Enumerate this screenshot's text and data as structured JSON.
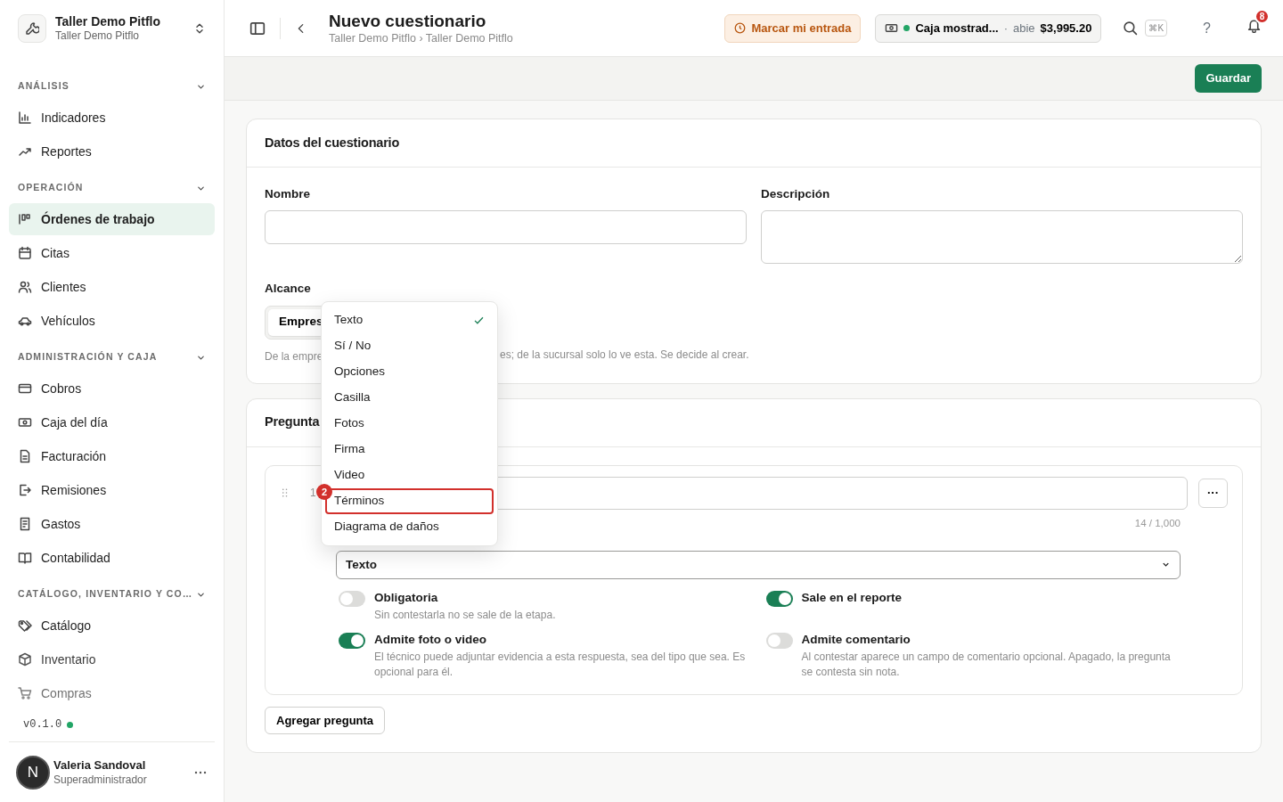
{
  "sidebar": {
    "workspace": {
      "name": "Taller Demo Pitflo",
      "subtitle": "Taller Demo Pitflo"
    },
    "sections": [
      {
        "title": "ANÁLISIS",
        "expanded": true,
        "items": [
          {
            "label": "Indicadores",
            "selected": false
          },
          {
            "label": "Reportes",
            "selected": false
          }
        ]
      },
      {
        "title": "OPERACIÓN",
        "expanded": true,
        "items": [
          {
            "label": "Órdenes de trabajo",
            "selected": true
          },
          {
            "label": "Citas",
            "selected": false
          },
          {
            "label": "Clientes",
            "selected": false
          },
          {
            "label": "Vehículos",
            "selected": false
          }
        ]
      },
      {
        "title": "ADMINISTRACIÓN Y CAJA",
        "expanded": true,
        "items": [
          {
            "label": "Cobros",
            "selected": false
          },
          {
            "label": "Caja del día",
            "selected": false
          },
          {
            "label": "Facturación",
            "selected": false
          },
          {
            "label": "Remisiones",
            "selected": false
          },
          {
            "label": "Gastos",
            "selected": false
          },
          {
            "label": "Contabilidad",
            "selected": false
          }
        ]
      },
      {
        "title": "CATÁLOGO, INVENTARIO Y CO…",
        "expanded": true,
        "items": [
          {
            "label": "Catálogo",
            "selected": false
          },
          {
            "label": "Inventario",
            "selected": false
          },
          {
            "label": "Compras",
            "selected": false
          }
        ]
      }
    ],
    "version": "v0.1.0",
    "user": {
      "initial": "N",
      "name": "Valeria Sandoval",
      "role": "Superadministrador"
    }
  },
  "header": {
    "title": "Nuevo cuestionario",
    "breadcrumb": [
      "Taller Demo Pitflo",
      "Taller Demo Pitflo"
    ],
    "breadcrumb_separator": "›",
    "clock_in": "Marcar mi entrada",
    "register": {
      "name": "Caja mostrad...",
      "separator": "·",
      "status": "abie",
      "amount": "$3,995.20"
    },
    "shortcut": "⌘K",
    "help": "?",
    "notifications": "8"
  },
  "save_button": "Guardar",
  "details": {
    "title": "Datos del cuestionario",
    "name_label": "Nombre",
    "description_label": "Descripción",
    "scope_label": "Alcance",
    "scope_option": "Empres",
    "hint_parts": [
      "De la empre",
      "es; de la sucursal solo lo ve esta. Se decide al crear."
    ]
  },
  "questions": {
    "title": "Pregunta",
    "items": [
      {
        "number": "1",
        "counter": "14 / 1,000",
        "type": "Texto",
        "more": "···",
        "toggles": [
          {
            "label": "Obligatoria",
            "description": "Sin contestarla no se sale de la etapa.",
            "on": false
          },
          {
            "label": "Sale en el reporte",
            "on": true
          },
          {
            "label": "Admite foto o video",
            "description": "El técnico puede adjuntar evidencia a esta respuesta, sea del tipo que sea. Es opcional para él.",
            "on": true
          },
          {
            "label": "Admite comentario",
            "description": "Al contestar aparece un campo de comentario opcional. Apagado, la pregunta se contesta sin nota.",
            "on": false
          }
        ]
      }
    ],
    "add_button": "Agregar pregunta"
  },
  "type_menu": {
    "options": [
      {
        "label": "Texto",
        "selected": true
      },
      {
        "label": "Sí / No",
        "selected": false
      },
      {
        "label": "Opciones",
        "selected": false
      },
      {
        "label": "Casilla",
        "selected": false
      },
      {
        "label": "Fotos",
        "selected": false
      },
      {
        "label": "Firma",
        "selected": false
      },
      {
        "label": "Video",
        "selected": false
      },
      {
        "label": "Términos",
        "selected": false,
        "highlighted": true,
        "badge": "2"
      },
      {
        "label": "Diagrama de daños",
        "selected": false
      }
    ]
  }
}
